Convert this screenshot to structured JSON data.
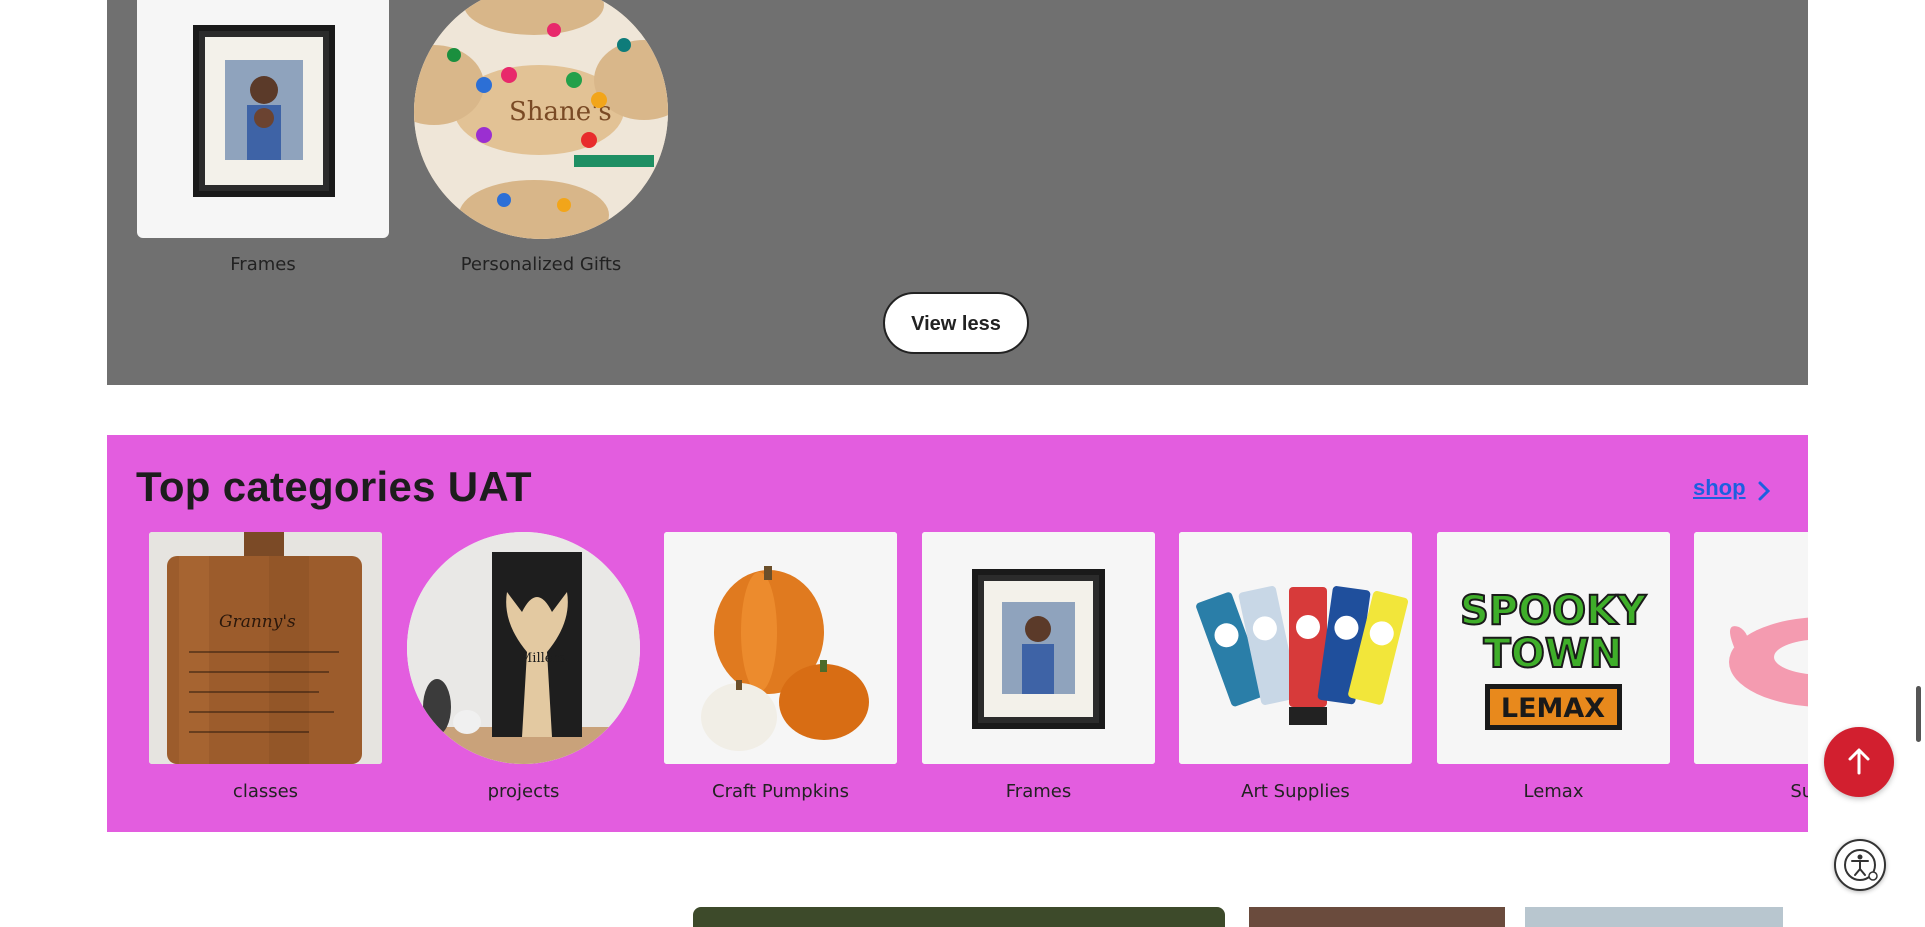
{
  "top_section": {
    "items": [
      {
        "label": "Frames"
      },
      {
        "label": "Personalized Gifts"
      }
    ],
    "view_less_label": "View less",
    "background": "#707070"
  },
  "categories": {
    "title": "Top categories UAT",
    "shop_label": "shop",
    "background": "#e35ddf",
    "items": [
      {
        "label": "classes",
        "image": "engraved-cutting-board"
      },
      {
        "label": "projects",
        "image": "carved-tree-sign"
      },
      {
        "label": "Craft Pumpkins",
        "image": "pumpkins"
      },
      {
        "label": "Frames",
        "image": "photo-frame"
      },
      {
        "label": "Art Supplies",
        "image": "paint-tubes"
      },
      {
        "label": "Lemax",
        "image": "spooky-town-logo",
        "logo_text": [
          "SPOOKY",
          "TOWN",
          "LEMAX"
        ]
      },
      {
        "label": "Sum",
        "image": "pink-pool-float"
      }
    ]
  },
  "colors": {
    "accent_red": "#d21f2f",
    "link_blue": "#1d5fe0"
  },
  "icons": {
    "scroll_top": "arrow-up-icon",
    "accessibility": "accessibility-icon",
    "shop_chevron": "chevron-right-icon"
  }
}
